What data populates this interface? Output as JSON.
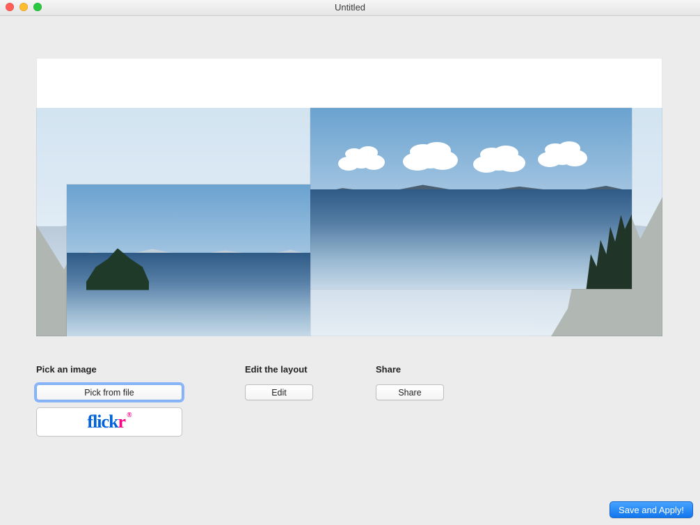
{
  "window": {
    "title": "Untitled"
  },
  "sections": {
    "pick": {
      "heading": "Pick an image",
      "pick_from_file": "Pick from file",
      "flickr_brand": "flickr"
    },
    "edit": {
      "heading": "Edit the layout",
      "edit_button": "Edit"
    },
    "share": {
      "heading": "Share",
      "share_button": "Share"
    }
  },
  "footer": {
    "save_apply": "Save and Apply!"
  }
}
